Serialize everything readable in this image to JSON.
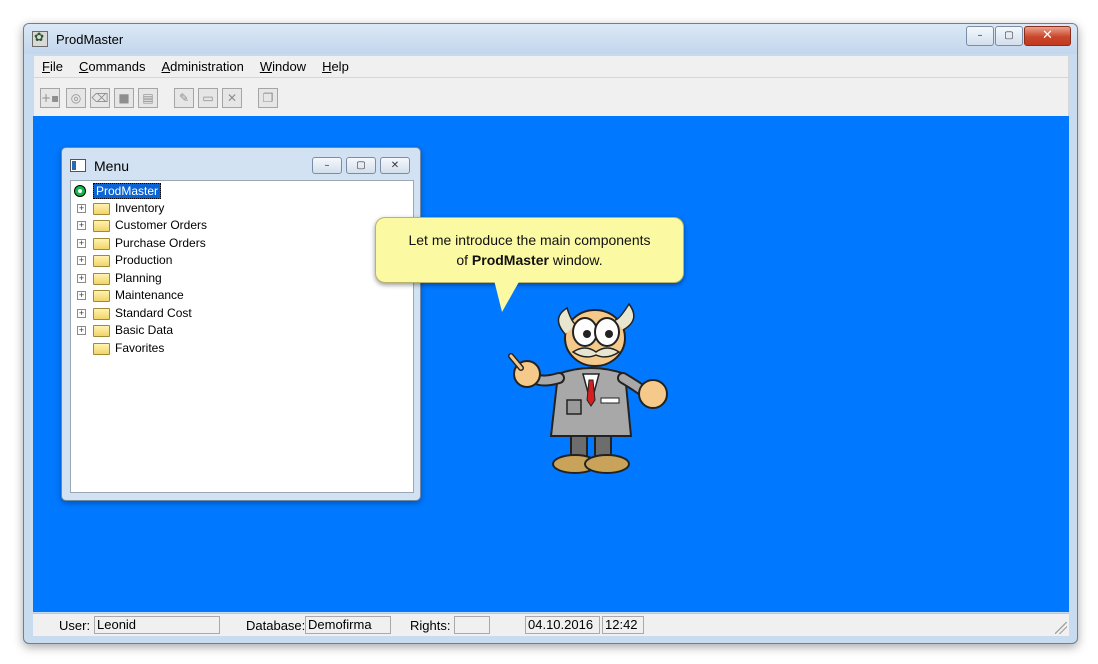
{
  "window": {
    "title": "ProdMaster",
    "controls": {
      "minimize": "–",
      "maximize": "▢",
      "close": "✕"
    }
  },
  "menubar": {
    "items": [
      {
        "label": "File"
      },
      {
        "label": "Commands"
      },
      {
        "label": "Administration"
      },
      {
        "label": "Window"
      },
      {
        "label": "Help"
      }
    ]
  },
  "toolbar": {
    "buttons": [
      {
        "icon": "insert-icon"
      },
      {
        "icon": "find-icon"
      },
      {
        "icon": "eraser-icon"
      },
      {
        "icon": "stop-icon"
      },
      {
        "icon": "document-icon"
      },
      {
        "icon": "edit-icon"
      },
      {
        "icon": "folder-icon"
      },
      {
        "icon": "delete-icon"
      },
      {
        "icon": "copy-icon"
      }
    ]
  },
  "child_window": {
    "title": "Menu",
    "tree": {
      "root": "ProdMaster",
      "items": [
        {
          "label": "Inventory",
          "expandable": true
        },
        {
          "label": "Customer Orders",
          "expandable": true
        },
        {
          "label": "Purchase Orders",
          "expandable": true
        },
        {
          "label": "Production",
          "expandable": true
        },
        {
          "label": "Planning",
          "expandable": true
        },
        {
          "label": "Maintenance",
          "expandable": true
        },
        {
          "label": "Standard Cost",
          "expandable": true
        },
        {
          "label": "Basic Data",
          "expandable": true
        },
        {
          "label": "Favorites",
          "expandable": false
        }
      ]
    }
  },
  "bubble": {
    "line1": "Let me introduce the main components",
    "line2_prefix": "of ",
    "line2_bold": "ProdMaster",
    "line2_suffix": " window."
  },
  "statusbar": {
    "user_label": "User:",
    "user_value": "Leonid",
    "database_label": "Database:",
    "database_value": "Demofirma",
    "rights_label": "Rights:",
    "rights_value": "",
    "date": "04.10.2016",
    "time": "12:42"
  },
  "colors": {
    "desktop": "#0078ff",
    "bubble": "#fbf9a2",
    "selection": "#0a64d6"
  }
}
